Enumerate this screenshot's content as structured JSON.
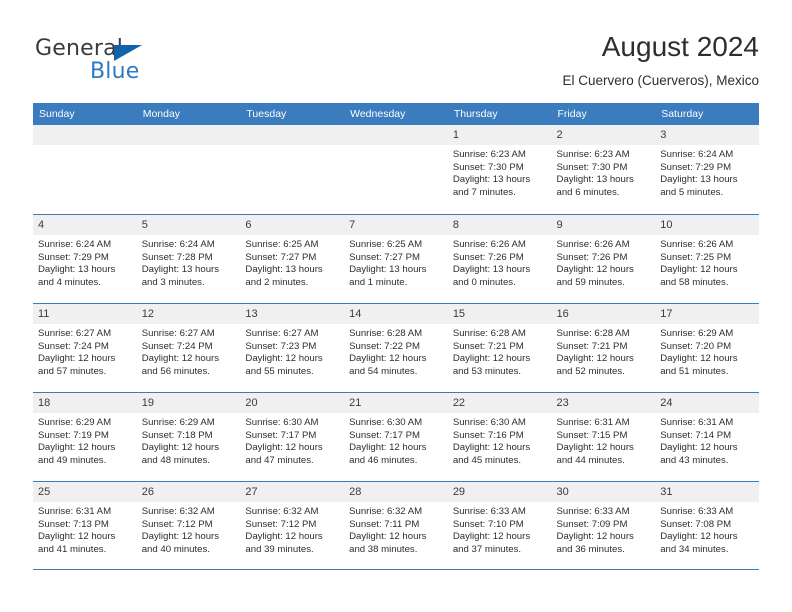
{
  "brand": {
    "name_part1": "General",
    "name_part2": "Blue",
    "triangle_color": "#1063a8",
    "blue_color": "#2b7cc4"
  },
  "header": {
    "title": "August 2024",
    "subtitle": "El Cuervero (Cuerveros), Mexico"
  },
  "theme": {
    "header_row_bg": "#3a7cbe",
    "day_band_bg": "#f0f0f0",
    "grid_line": "#3a7cbe",
    "text": "#2e2e2e"
  },
  "weekdays": [
    "Sunday",
    "Monday",
    "Tuesday",
    "Wednesday",
    "Thursday",
    "Friday",
    "Saturday"
  ],
  "weeks": [
    [
      {
        "day": "",
        "lines": []
      },
      {
        "day": "",
        "lines": []
      },
      {
        "day": "",
        "lines": []
      },
      {
        "day": "",
        "lines": []
      },
      {
        "day": "1",
        "lines": [
          "Sunrise: 6:23 AM",
          "Sunset: 7:30 PM",
          "Daylight: 13 hours",
          "and 7 minutes."
        ]
      },
      {
        "day": "2",
        "lines": [
          "Sunrise: 6:23 AM",
          "Sunset: 7:30 PM",
          "Daylight: 13 hours",
          "and 6 minutes."
        ]
      },
      {
        "day": "3",
        "lines": [
          "Sunrise: 6:24 AM",
          "Sunset: 7:29 PM",
          "Daylight: 13 hours",
          "and 5 minutes."
        ]
      }
    ],
    [
      {
        "day": "4",
        "lines": [
          "Sunrise: 6:24 AM",
          "Sunset: 7:29 PM",
          "Daylight: 13 hours",
          "and 4 minutes."
        ]
      },
      {
        "day": "5",
        "lines": [
          "Sunrise: 6:24 AM",
          "Sunset: 7:28 PM",
          "Daylight: 13 hours",
          "and 3 minutes."
        ]
      },
      {
        "day": "6",
        "lines": [
          "Sunrise: 6:25 AM",
          "Sunset: 7:27 PM",
          "Daylight: 13 hours",
          "and 2 minutes."
        ]
      },
      {
        "day": "7",
        "lines": [
          "Sunrise: 6:25 AM",
          "Sunset: 7:27 PM",
          "Daylight: 13 hours",
          "and 1 minute."
        ]
      },
      {
        "day": "8",
        "lines": [
          "Sunrise: 6:26 AM",
          "Sunset: 7:26 PM",
          "Daylight: 13 hours",
          "and 0 minutes."
        ]
      },
      {
        "day": "9",
        "lines": [
          "Sunrise: 6:26 AM",
          "Sunset: 7:26 PM",
          "Daylight: 12 hours",
          "and 59 minutes."
        ]
      },
      {
        "day": "10",
        "lines": [
          "Sunrise: 6:26 AM",
          "Sunset: 7:25 PM",
          "Daylight: 12 hours",
          "and 58 minutes."
        ]
      }
    ],
    [
      {
        "day": "11",
        "lines": [
          "Sunrise: 6:27 AM",
          "Sunset: 7:24 PM",
          "Daylight: 12 hours",
          "and 57 minutes."
        ]
      },
      {
        "day": "12",
        "lines": [
          "Sunrise: 6:27 AM",
          "Sunset: 7:24 PM",
          "Daylight: 12 hours",
          "and 56 minutes."
        ]
      },
      {
        "day": "13",
        "lines": [
          "Sunrise: 6:27 AM",
          "Sunset: 7:23 PM",
          "Daylight: 12 hours",
          "and 55 minutes."
        ]
      },
      {
        "day": "14",
        "lines": [
          "Sunrise: 6:28 AM",
          "Sunset: 7:22 PM",
          "Daylight: 12 hours",
          "and 54 minutes."
        ]
      },
      {
        "day": "15",
        "lines": [
          "Sunrise: 6:28 AM",
          "Sunset: 7:21 PM",
          "Daylight: 12 hours",
          "and 53 minutes."
        ]
      },
      {
        "day": "16",
        "lines": [
          "Sunrise: 6:28 AM",
          "Sunset: 7:21 PM",
          "Daylight: 12 hours",
          "and 52 minutes."
        ]
      },
      {
        "day": "17",
        "lines": [
          "Sunrise: 6:29 AM",
          "Sunset: 7:20 PM",
          "Daylight: 12 hours",
          "and 51 minutes."
        ]
      }
    ],
    [
      {
        "day": "18",
        "lines": [
          "Sunrise: 6:29 AM",
          "Sunset: 7:19 PM",
          "Daylight: 12 hours",
          "and 49 minutes."
        ]
      },
      {
        "day": "19",
        "lines": [
          "Sunrise: 6:29 AM",
          "Sunset: 7:18 PM",
          "Daylight: 12 hours",
          "and 48 minutes."
        ]
      },
      {
        "day": "20",
        "lines": [
          "Sunrise: 6:30 AM",
          "Sunset: 7:17 PM",
          "Daylight: 12 hours",
          "and 47 minutes."
        ]
      },
      {
        "day": "21",
        "lines": [
          "Sunrise: 6:30 AM",
          "Sunset: 7:17 PM",
          "Daylight: 12 hours",
          "and 46 minutes."
        ]
      },
      {
        "day": "22",
        "lines": [
          "Sunrise: 6:30 AM",
          "Sunset: 7:16 PM",
          "Daylight: 12 hours",
          "and 45 minutes."
        ]
      },
      {
        "day": "23",
        "lines": [
          "Sunrise: 6:31 AM",
          "Sunset: 7:15 PM",
          "Daylight: 12 hours",
          "and 44 minutes."
        ]
      },
      {
        "day": "24",
        "lines": [
          "Sunrise: 6:31 AM",
          "Sunset: 7:14 PM",
          "Daylight: 12 hours",
          "and 43 minutes."
        ]
      }
    ],
    [
      {
        "day": "25",
        "lines": [
          "Sunrise: 6:31 AM",
          "Sunset: 7:13 PM",
          "Daylight: 12 hours",
          "and 41 minutes."
        ]
      },
      {
        "day": "26",
        "lines": [
          "Sunrise: 6:32 AM",
          "Sunset: 7:12 PM",
          "Daylight: 12 hours",
          "and 40 minutes."
        ]
      },
      {
        "day": "27",
        "lines": [
          "Sunrise: 6:32 AM",
          "Sunset: 7:12 PM",
          "Daylight: 12 hours",
          "and 39 minutes."
        ]
      },
      {
        "day": "28",
        "lines": [
          "Sunrise: 6:32 AM",
          "Sunset: 7:11 PM",
          "Daylight: 12 hours",
          "and 38 minutes."
        ]
      },
      {
        "day": "29",
        "lines": [
          "Sunrise: 6:33 AM",
          "Sunset: 7:10 PM",
          "Daylight: 12 hours",
          "and 37 minutes."
        ]
      },
      {
        "day": "30",
        "lines": [
          "Sunrise: 6:33 AM",
          "Sunset: 7:09 PM",
          "Daylight: 12 hours",
          "and 36 minutes."
        ]
      },
      {
        "day": "31",
        "lines": [
          "Sunrise: 6:33 AM",
          "Sunset: 7:08 PM",
          "Daylight: 12 hours",
          "and 34 minutes."
        ]
      }
    ]
  ]
}
